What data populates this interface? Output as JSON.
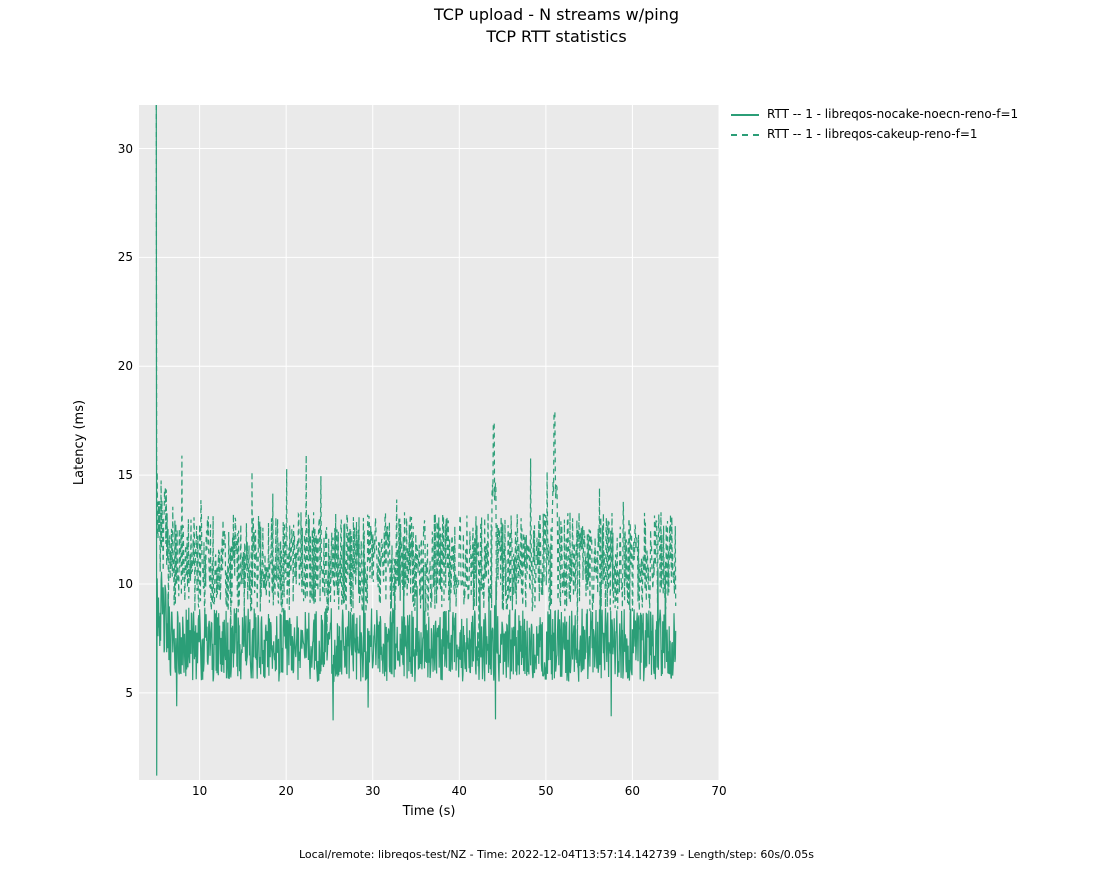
{
  "title": "TCP upload - N streams w/ping",
  "subtitle": "TCP RTT statistics",
  "xlabel": "Time (s)",
  "ylabel": "Latency (ms)",
  "footer": "Local/remote: libreqos-test/NZ - Time: 2022-12-04T13:57:14.142739 - Length/step: 60s/0.05s",
  "legend": [
    {
      "style": "solid",
      "text": "RTT -- 1 - libreqos-nocake-noecn-reno-f=1"
    },
    {
      "style": "dashed",
      "text": "RTT -- 1 - libreqos-cakeup-reno-f=1"
    }
  ],
  "chart_data": {
    "type": "line",
    "xlabel": "Time (s)",
    "ylabel": "Latency (ms)",
    "xlim": [
      3,
      70
    ],
    "ylim": [
      1,
      32
    ],
    "xticks": [
      10,
      20,
      30,
      40,
      50,
      60,
      70
    ],
    "yticks": [
      5,
      10,
      15,
      20,
      25,
      30
    ],
    "color": "#2b9e77",
    "series": [
      {
        "name": "RTT -- 1 - libreqos-nocake-noecn-reno-f=1",
        "style": "solid",
        "x_range": [
          5,
          65
        ],
        "summary": {
          "baseline": 7.2,
          "jitter_low": 5.8,
          "jitter_high": 9.2,
          "initial_spike": 32,
          "initial_dip": 1.2
        }
      },
      {
        "name": "RTT -- 1 - libreqos-cakeup-reno-f=1",
        "style": "dashed",
        "x_range": [
          5,
          65
        ],
        "summary": {
          "baseline": 11.0,
          "jitter_low": 8.8,
          "jitter_high": 13.4,
          "initial_spike": 32,
          "spikes": [
            {
              "x": 44,
              "y": 17.4
            },
            {
              "x": 51,
              "y": 17.9
            }
          ]
        }
      }
    ]
  }
}
